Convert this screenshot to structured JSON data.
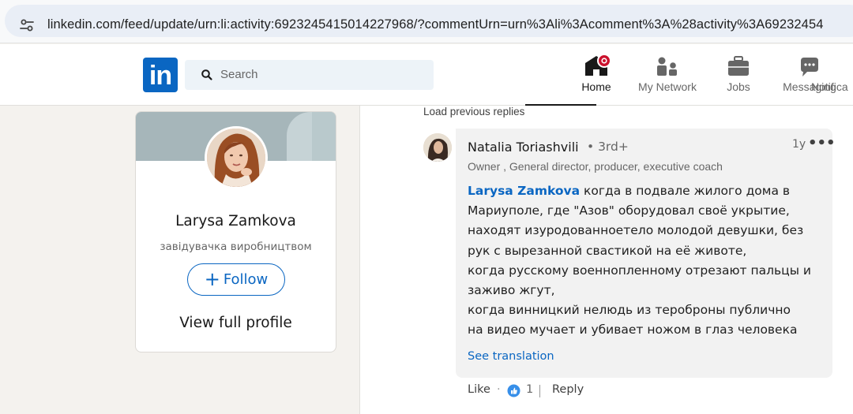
{
  "browser": {
    "url": "linkedin.com/feed/update/urn:li:activity:6923245415014227968/?commentUrn=urn%3Ali%3Acomment%3A%28activity%3A69232454"
  },
  "nav": {
    "logo": "in",
    "search_placeholder": "Search",
    "items": [
      {
        "label": "Home",
        "icon": "home-icon",
        "active": true,
        "badge": true
      },
      {
        "label": "My Network",
        "icon": "people-icon"
      },
      {
        "label": "Jobs",
        "icon": "briefcase-icon"
      },
      {
        "label": "Messaging",
        "icon": "chat-icon"
      },
      {
        "label": "Notifica",
        "icon": "bell-icon"
      }
    ]
  },
  "profile_card": {
    "name": "Larysa Zamkova",
    "headline": "завідувачка виробництвом",
    "follow_label": "Follow",
    "follow_plus": "+",
    "view_profile_label": "View full profile"
  },
  "comment": {
    "load_previous": "Load previous replies",
    "author": "Natalia Toriashvili",
    "degree": "• 3rd+",
    "time": "1y",
    "more": "•••",
    "headline": "Owner , General director, producer, executive coach",
    "mention": "Larysa Zamkova",
    "lines": [
      " когда в подвале жилого дома в",
      "Мариуполе, где \"Азов\" оборудовал своё укрытие,",
      "находят изуродованноетело молодой девушки, без",
      "рук с вырезанной свастикой на её животе,",
      "когда русскому военнопленному отрезают пальцы и",
      "заживо жгут,",
      "когда винницкий нелюдь из тероброны публично",
      "на видео мучает и убивает ножом в глаз человека"
    ],
    "see_translation": "See translation",
    "actions": {
      "like": "Like",
      "dot": "·",
      "reaction_count": "1",
      "reply": "Reply"
    }
  },
  "colors": {
    "brand": "#0a66c2",
    "background": "#f4f2ee",
    "badge": "#cb112d"
  }
}
